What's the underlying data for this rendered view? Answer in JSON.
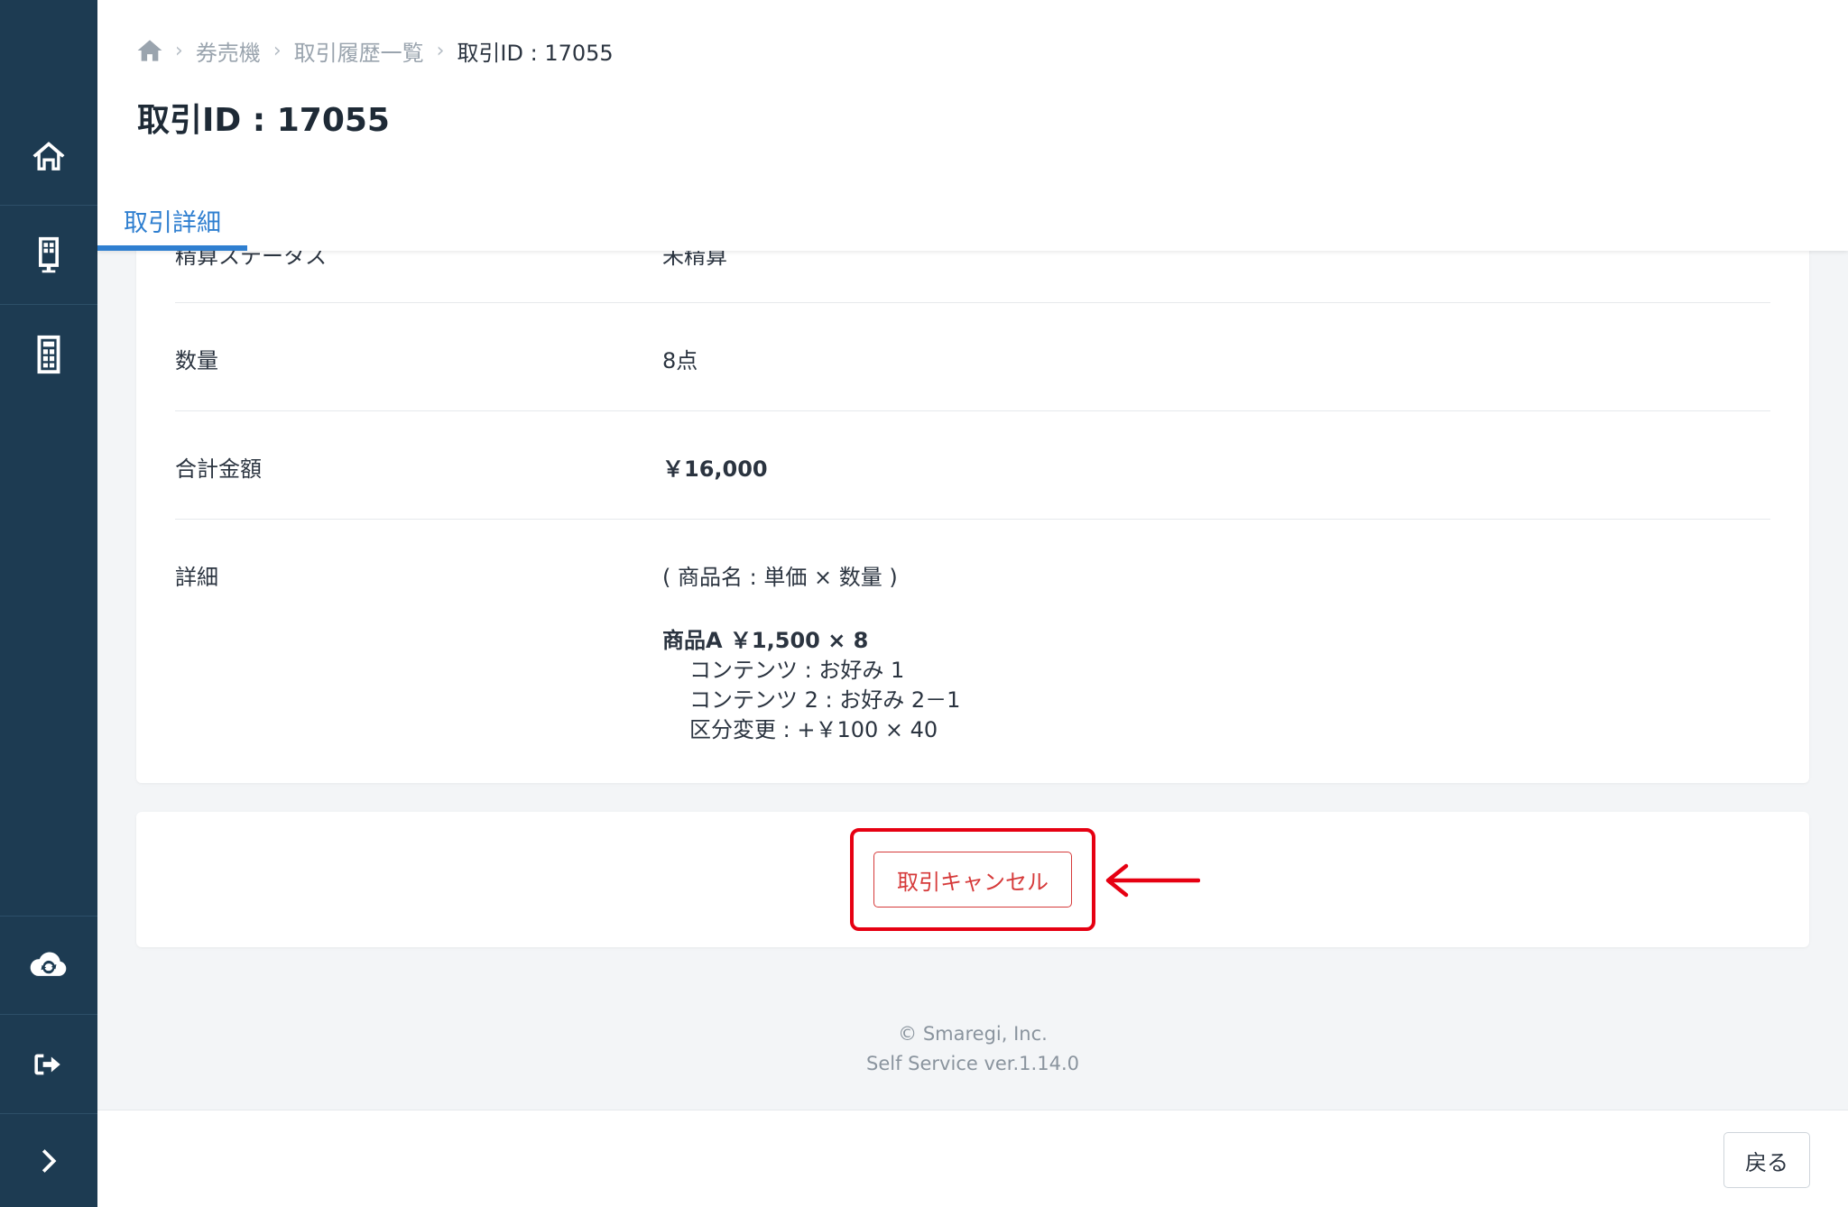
{
  "sidebar": {
    "items": [
      {
        "name": "home-icon"
      },
      {
        "name": "ticket-machine-icon"
      },
      {
        "name": "tablet-icon"
      },
      {
        "name": "cloud-sync-icon"
      },
      {
        "name": "logout-icon"
      },
      {
        "name": "chevron-right-icon"
      }
    ]
  },
  "breadcrumb": {
    "items": [
      "券売機",
      "取引履歴一覧"
    ],
    "current": "取引ID : 17055"
  },
  "header": {
    "title": "取引ID : 17055",
    "tab_label": "取引詳細"
  },
  "details": {
    "partial_label": "精算ステータス",
    "partial_value": "未精算",
    "rows": [
      {
        "label": "数量",
        "value": "8点"
      },
      {
        "label": "合計金額",
        "value": "￥16,000"
      },
      {
        "label": "詳細",
        "value": "( 商品名 : 単価 × 数量 )"
      }
    ],
    "item_line": "商品A ￥1,500 × 8",
    "sub_lines": [
      "コンテンツ : お好み 1",
      "コンテンツ 2 : お好み 2－1",
      "区分変更 : +￥100 × 40"
    ]
  },
  "actions": {
    "cancel_label": "取引キャンセル"
  },
  "footer": {
    "copyright": "© Smaregi, Inc.",
    "version": "Self Service ver.1.14.0"
  },
  "bottom": {
    "back_label": "戻る"
  },
  "colors": {
    "sidebar": "#1d3b52",
    "accent": "#2f7fd0",
    "danger": "#d63a3a",
    "highlight": "#e60012"
  }
}
